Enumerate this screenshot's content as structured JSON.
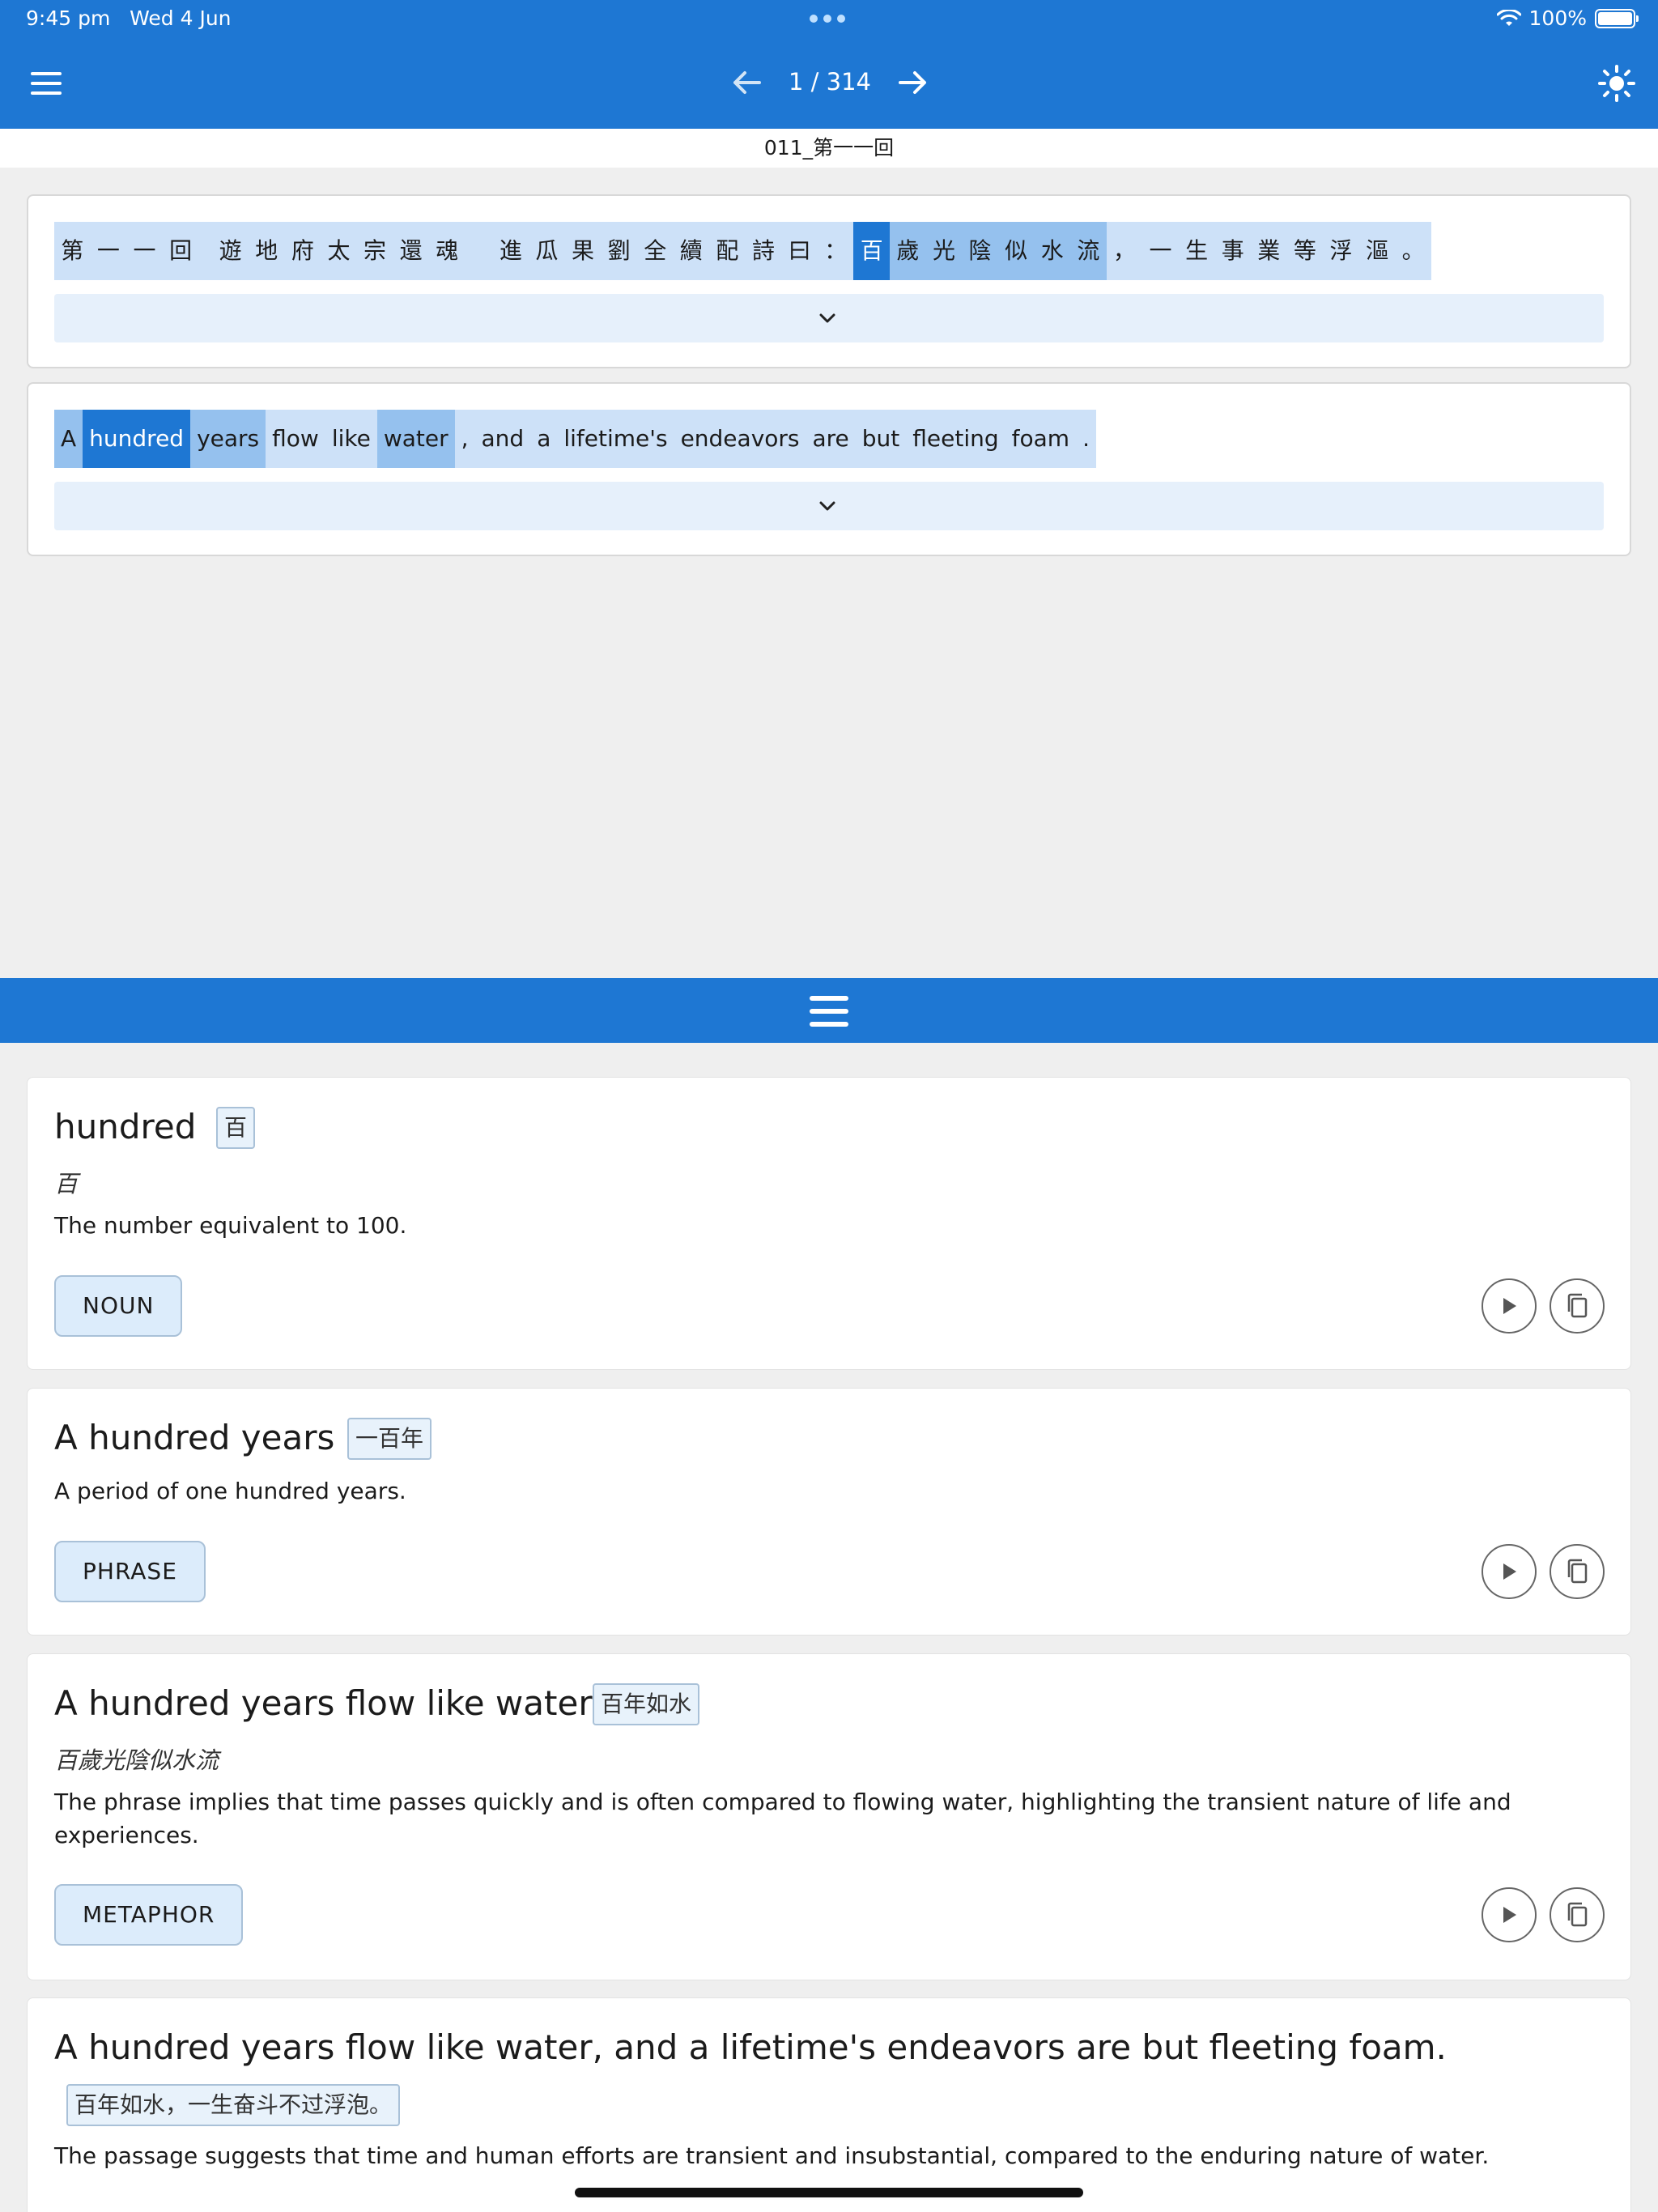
{
  "status_bar": {
    "time": "9:45 pm",
    "date": "Wed 4 Jun",
    "battery": "100%"
  },
  "toolbar": {
    "page_counter": "1 / 314"
  },
  "chapter": {
    "title": "011_第一一回"
  },
  "chinese_sentence": {
    "tokens": [
      "第",
      "一",
      "一",
      "回",
      " ",
      "遊",
      "地",
      "府",
      "太",
      "宗",
      "還",
      "魂",
      " ",
      " ",
      "進",
      "瓜",
      "果",
      "劉",
      "全",
      "續",
      "配",
      "詩",
      "曰",
      "：",
      "百",
      "歲",
      "光",
      "陰",
      "似",
      "水",
      "流",
      "，",
      "一",
      "生",
      "事",
      "業",
      "等",
      "浮",
      "漚",
      "。"
    ]
  },
  "english_sentence": {
    "tokens": [
      "A",
      "hundred",
      "years",
      "flow",
      "like",
      "water",
      ",",
      "and",
      "a",
      "lifetime's",
      "endeavors",
      "are",
      "but",
      "fleeting",
      "foam",
      "."
    ]
  },
  "definitions": [
    {
      "term": "hundred",
      "zh": "百",
      "original": "百",
      "definition": "The number equivalent to 100.",
      "pos": "NOUN"
    },
    {
      "term": "A hundred years",
      "zh": "一百年",
      "original": "",
      "definition": "A period of one hundred years.",
      "pos": "PHRASE"
    },
    {
      "term": "A hundred years flow like water",
      "zh": "百年如水",
      "original": "百歲光陰似水流",
      "definition": "The phrase implies that time passes quickly and is often compared to flowing water, highlighting the transient nature of life and experiences.",
      "pos": "METAPHOR"
    },
    {
      "term": "A hundred years flow like water, and a lifetime's endeavors are but fleeting foam.",
      "zh": "百年如水，一生奋斗不过浮泡。",
      "original": "",
      "definition": "The passage suggests that time and human efforts are transient and insubstantial, compared to the enduring nature of water.",
      "pos": ""
    }
  ],
  "colors": {
    "primary": "#1e77d3",
    "highlight_light": "#cde1f8",
    "highlight_mid": "#95c1ee"
  },
  "icons": [
    "menu-icon",
    "arrow-left-icon",
    "arrow-right-icon",
    "sun-icon",
    "wifi-icon",
    "battery-icon",
    "chevron-down-icon",
    "drag-handle-icon",
    "play-icon",
    "copy-icon"
  ]
}
